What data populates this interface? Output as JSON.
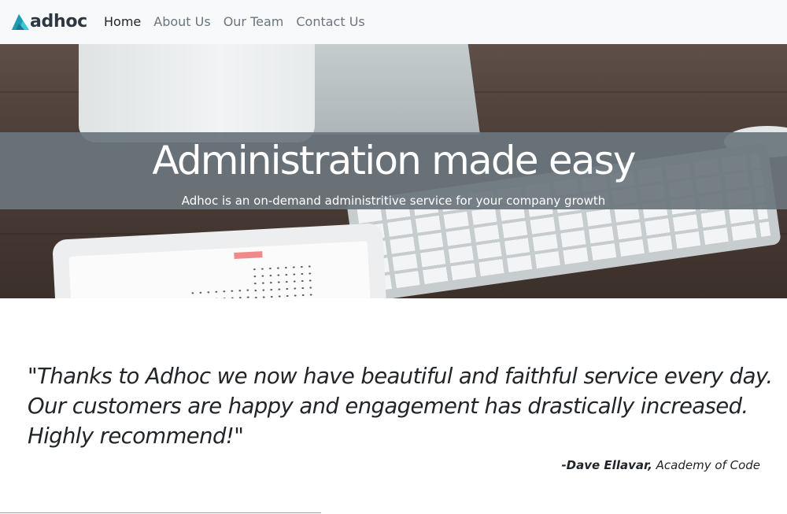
{
  "brand": {
    "name": "adhoc",
    "logo_colors": {
      "light": "#3cc6d6",
      "dark": "#1a8fa8"
    }
  },
  "nav": {
    "items": [
      {
        "label": "Home",
        "active": true
      },
      {
        "label": "About Us",
        "active": false
      },
      {
        "label": "Our Team",
        "active": false
      },
      {
        "label": "Contact Us",
        "active": false
      }
    ]
  },
  "hero": {
    "title": "Administration made easy",
    "subtitle": "Adhoc is an on-demand administritive service for your company growth",
    "banner_color": "#6c757d"
  },
  "testimonial": {
    "quote": "\"Thanks to Adhoc we now have beautiful and faithful service every day. Our customers are happy and engagement has drastically increased. Highly recommend!\"",
    "author": "-Dave Ellavar,",
    "company": "Academy of Code"
  }
}
